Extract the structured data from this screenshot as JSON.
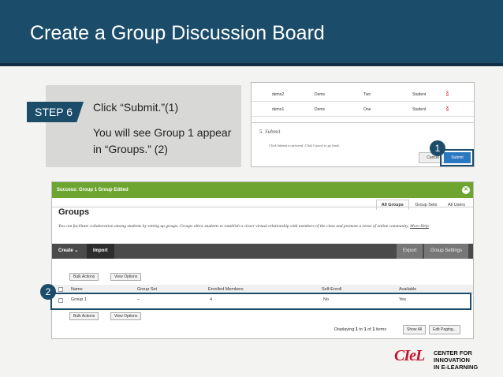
{
  "slide_title": "Create a Group Discussion Board",
  "step": {
    "tag": "STEP 6",
    "instruction": "Click “Submit.”(1)",
    "result": "You will see Group 1 appear in “Groups.” (2)"
  },
  "badges": {
    "one": "1",
    "two": "2"
  },
  "submit_shot": {
    "rows": [
      {
        "user": "demo2",
        "name": "Dems",
        "last": "Two",
        "role": "Student",
        "remove": "x"
      },
      {
        "user": "demo1",
        "name": "Dems",
        "last": "One",
        "role": "Student",
        "remove": "x"
      }
    ],
    "section_heading": "5.  Submit",
    "section_text": "Click Submit to proceed. Click Cancel to go back.",
    "cancel_label": "Cancel",
    "submit_label": "Submit"
  },
  "groups_shot": {
    "success_message": "Success: Group 1 Group Edited",
    "close_icon": "close-icon",
    "tabs": [
      "All Groups",
      "Group Sets",
      "All Users"
    ],
    "title": "Groups",
    "description": "You can facilitate collaboration among students by setting up groups. Groups allow students to establish a closer virtual relationship with members of the class and promote a sense of online community.",
    "more_help": "More Help",
    "action_bar": {
      "create": "Create",
      "import": "Import",
      "export": "Export",
      "settings": "Group Settings"
    },
    "bulk_actions": "Bulk Actions",
    "view_options": "View Options",
    "columns": [
      "Name",
      "Group Set",
      "Enrolled Members",
      "Self-Enroll",
      "Available"
    ],
    "rows": [
      {
        "name": "Group 1",
        "group_set": "–",
        "enrolled": "4",
        "self_enroll": "No",
        "available": "Yes"
      }
    ],
    "pagination": {
      "prefix": "Displaying",
      "from": "1",
      "to_label": "to",
      "to": "1",
      "of_label": "of",
      "total": "1",
      "suffix": "items"
    },
    "show_all": "Show All",
    "edit_paging": "Edit Paging..."
  },
  "logo": {
    "mark": "CIeL",
    "line1": "CENTER FOR INNOVATION",
    "line2": "IN E-LEARNING"
  },
  "colors": {
    "header": "#1b4d6b",
    "success": "#6ea531",
    "submit": "#2a78c2",
    "logo_red": "#c8102e"
  }
}
